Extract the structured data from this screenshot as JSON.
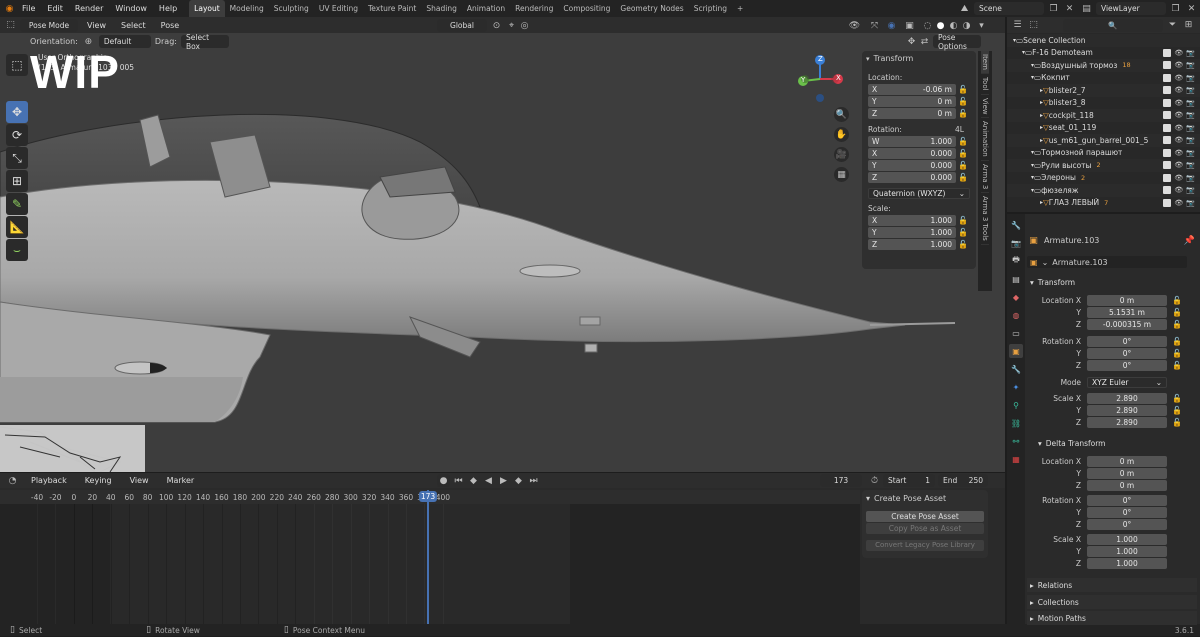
{
  "topbar": {
    "menus": [
      "File",
      "Edit",
      "Render",
      "Window",
      "Help"
    ],
    "workspaces": [
      "Layout",
      "Modeling",
      "Sculpting",
      "UV Editing",
      "Texture Paint",
      "Shading",
      "Animation",
      "Rendering",
      "Compositing",
      "Geometry Nodes",
      "Scripting"
    ],
    "active_workspace": "Layout",
    "add_tab": "+",
    "scene": "Scene",
    "view_layer": "ViewLayer"
  },
  "viewport": {
    "mode": "Pose Mode",
    "menus": [
      "View",
      "Select",
      "Pose"
    ],
    "transform_orientation": "Global",
    "orientation_label": "Orientation:",
    "orientation_value": "Default",
    "drag_label": "Drag:",
    "drag_value": "Select Box",
    "pose_options": "Pose Options",
    "overlay_text_line1": "User Orthographic",
    "overlay_text_line2": "(173) Armature.103 : 005",
    "watermark": "WIP",
    "gizmo": {
      "x": "X",
      "y": "Y",
      "z": "Z"
    }
  },
  "npanel": {
    "title": "Transform",
    "location_label": "Location:",
    "location": [
      {
        "axis": "X",
        "value": "-0.06 m"
      },
      {
        "axis": "Y",
        "value": "0 m"
      },
      {
        "axis": "Z",
        "value": "0 m"
      }
    ],
    "rotation_label": "Rotation:",
    "rotation_mode_short": "4L",
    "rotation": [
      {
        "axis": "W",
        "value": "1.000"
      },
      {
        "axis": "X",
        "value": "0.000"
      },
      {
        "axis": "Y",
        "value": "0.000"
      },
      {
        "axis": "Z",
        "value": "0.000"
      }
    ],
    "rotation_mode": "Quaternion (WXYZ)",
    "scale_label": "Scale:",
    "scale": [
      {
        "axis": "X",
        "value": "1.000"
      },
      {
        "axis": "Y",
        "value": "1.000"
      },
      {
        "axis": "Z",
        "value": "1.000"
      }
    ],
    "side_tabs": [
      "Item",
      "Tool",
      "View",
      "Animation",
      "Arma 3",
      "Arma 3 Tools"
    ]
  },
  "timeline": {
    "menus": [
      "Playback",
      "Keying",
      "View",
      "Marker"
    ],
    "current_frame": "173",
    "start_label": "Start",
    "start": "1",
    "end_label": "End",
    "end": "250",
    "ticks": [
      "-40",
      "-20",
      "0",
      "20",
      "40",
      "60",
      "80",
      "100",
      "120",
      "140",
      "160",
      "180",
      "200",
      "220",
      "240",
      "260",
      "280",
      "300",
      "320",
      "340",
      "360",
      "380",
      "400"
    ],
    "playhead_label": "173",
    "pose_panel": {
      "title": "Create Pose Asset",
      "create": "Create Pose Asset",
      "copy": "Copy Pose as Asset",
      "convert": "Convert Legacy Pose Library"
    }
  },
  "statusbar": {
    "select": "Select",
    "rotate": "Rotate View",
    "context": "Pose Context Menu",
    "version": "3.6.1"
  },
  "outliner": {
    "rows": [
      {
        "name": "Scene Collection",
        "indent": 0,
        "badge": ""
      },
      {
        "name": "F-16 Demoteam",
        "indent": 1,
        "badge": ""
      },
      {
        "name": "Воздушный тормоз",
        "indent": 2,
        "badge": "18"
      },
      {
        "name": "Кокпит",
        "indent": 2,
        "badge": ""
      },
      {
        "name": "blister2_7",
        "indent": 3,
        "badge": ""
      },
      {
        "name": "blister3_8",
        "indent": 3,
        "badge": ""
      },
      {
        "name": "cockpit_118",
        "indent": 3,
        "badge": ""
      },
      {
        "name": "seat_01_119",
        "indent": 3,
        "badge": ""
      },
      {
        "name": "us_m61_gun_barrel_001_5",
        "indent": 3,
        "badge": ""
      },
      {
        "name": "Тормозной парашют",
        "indent": 2,
        "badge": ""
      },
      {
        "name": "Рули высоты",
        "indent": 2,
        "badge": "2"
      },
      {
        "name": "Элероны",
        "indent": 2,
        "badge": "2"
      },
      {
        "name": "фюзеляж",
        "indent": 2,
        "badge": ""
      },
      {
        "name": "ГЛАЗ ЛЕВЫЙ",
        "indent": 3,
        "badge": "7"
      }
    ]
  },
  "properties": {
    "object_name": "Armature.103",
    "data_name": "Armature.103",
    "transform_header": "Transform",
    "location_x_label": "Location X",
    "location": [
      "0 m",
      "5.1531 m",
      "-0.000315 m"
    ],
    "rotation_x_label": "Rotation X",
    "rotation": [
      "0°",
      "0°",
      "0°"
    ],
    "mode_label": "Mode",
    "mode": "XYZ Euler",
    "scale_x_label": "Scale X",
    "scale": [
      "2.890",
      "2.890",
      "2.890"
    ],
    "delta_header": "Delta Transform",
    "delta_location": [
      "0 m",
      "0 m",
      "0 m"
    ],
    "delta_rotation": [
      "0°",
      "0°",
      "0°"
    ],
    "delta_scale": [
      "1.000",
      "1.000",
      "1.000"
    ],
    "axis_y": "Y",
    "axis_z": "Z",
    "relations": "Relations",
    "collections": "Collections",
    "motion_paths": "Motion Paths"
  },
  "colors": {
    "accent": "#4772b3",
    "viewport_bg": "#3d3d3d",
    "panel_bg": "#2a2a2a"
  }
}
